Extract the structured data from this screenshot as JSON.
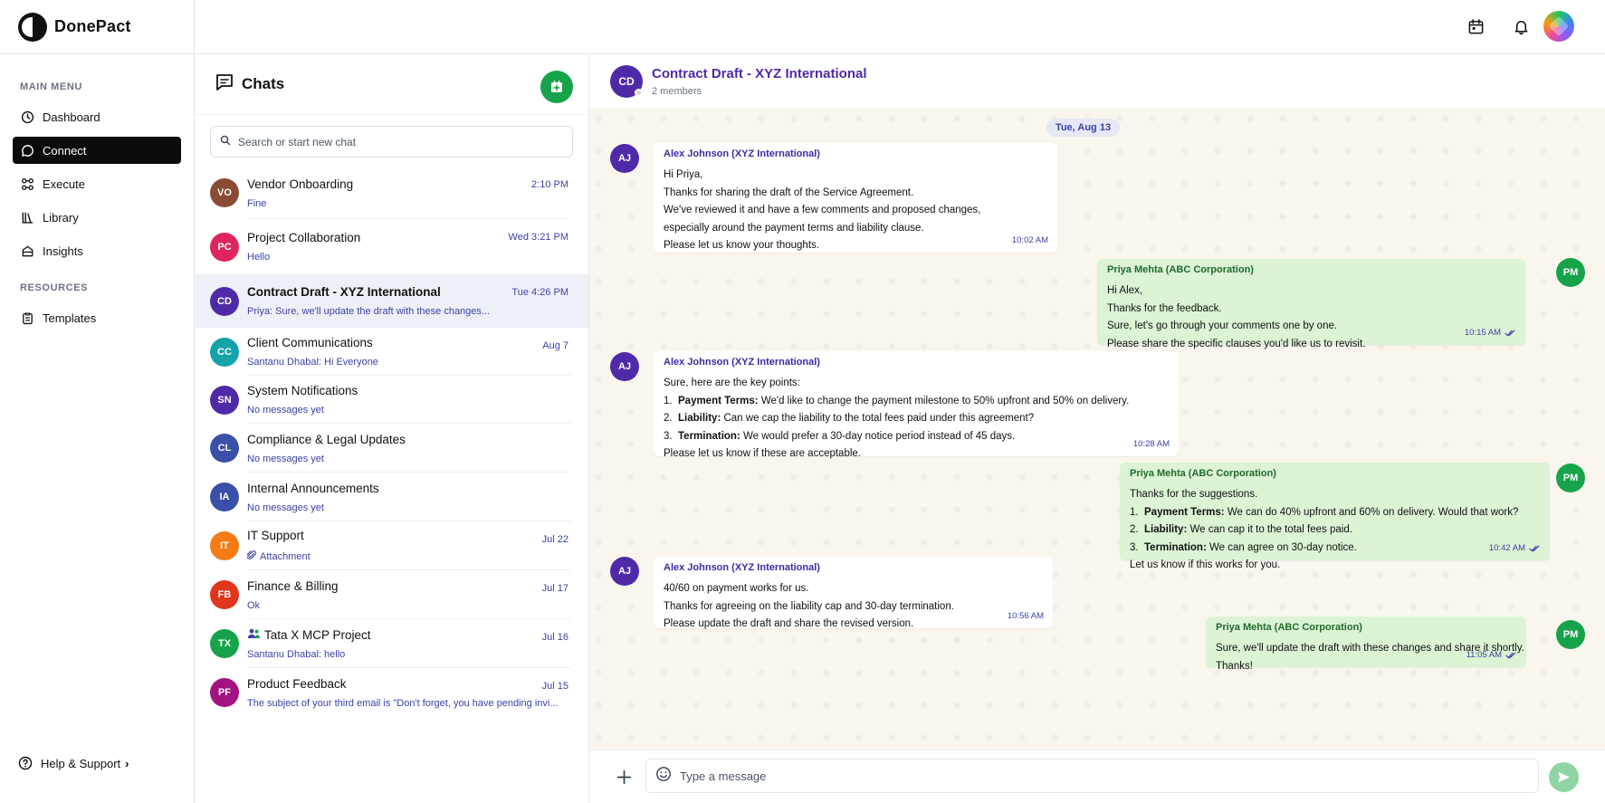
{
  "app": {
    "name": "DonePact"
  },
  "sidebar": {
    "main_menu_label": "MAIN MENU",
    "items": [
      {
        "label": "Dashboard",
        "icon": "clock-icon"
      },
      {
        "label": "Connect",
        "icon": "chat-bubble-icon",
        "active": true
      },
      {
        "label": "Execute",
        "icon": "nodes-icon"
      },
      {
        "label": "Library",
        "icon": "library-icon"
      },
      {
        "label": "Insights",
        "icon": "insights-icon"
      }
    ],
    "resources_label": "RESOURCES",
    "resources": [
      {
        "label": "Templates",
        "icon": "clipboard-icon"
      }
    ],
    "help_label": "Help & Support",
    "help_chevron": "›"
  },
  "topbar": {
    "icons": [
      "calendar-icon",
      "bell-icon",
      "user-avatar"
    ]
  },
  "chatlist": {
    "title": "Chats",
    "search_placeholder": "Search or start new chat",
    "chats": [
      {
        "initials": "VO",
        "color": "#8a4b35",
        "name": "Vendor Onboarding",
        "time": "2:10 PM",
        "preview": "Fine"
      },
      {
        "initials": "PC",
        "color": "#e0245e",
        "name": "Project Collaboration",
        "time": "Wed 3:21 PM",
        "preview": "Hello"
      },
      {
        "initials": "CD",
        "color": "#4f2aa8",
        "name": "Contract Draft - XYZ International",
        "time": "Tue 4:26 PM",
        "preview": "Priya: Sure, we'll update the draft with these changes...",
        "active": true
      },
      {
        "initials": "CC",
        "color": "#14a3a8",
        "name": "Client Communications",
        "time": "Aug 7",
        "preview": "Santanu Dhabal: Hi Everyone"
      },
      {
        "initials": "SN",
        "color": "#4f2aa8",
        "name": "System Notifications",
        "time": "",
        "preview": "No messages yet"
      },
      {
        "initials": "CL",
        "color": "#3a4fa8",
        "name": "Compliance & Legal Updates",
        "time": "",
        "preview": "No messages yet"
      },
      {
        "initials": "IA",
        "color": "#3a4fa8",
        "name": "Internal Announcements",
        "time": "",
        "preview": "No messages yet"
      },
      {
        "initials": "IT",
        "color": "#f47b16",
        "name": "IT Support",
        "time": "Jul 22",
        "preview": "Attachment",
        "preview_icon": "paperclip-icon"
      },
      {
        "initials": "FB",
        "color": "#e0361d",
        "name": "Finance & Billing",
        "time": "Jul 17",
        "preview": "Ok"
      },
      {
        "initials": "TX",
        "color": "#16a34a",
        "name": "Tata X MCP Project",
        "time": "Jul 16",
        "preview": "Santanu Dhabal: hello",
        "name_icon": "group-icon"
      },
      {
        "initials": "PF",
        "color": "#a3137f",
        "name": "Product Feedback",
        "time": "Jul 15",
        "preview": "The subject of your third email is \"Don't forget, you have pending invi..."
      }
    ]
  },
  "conversation": {
    "initials": "CD",
    "title": "Contract Draft - XYZ International",
    "subtitle": "2 members",
    "date_label": "Tue, Aug 13",
    "messages": [
      {
        "dir": "in",
        "initials": "AJ",
        "sender": "Alex Johnson (XYZ International)",
        "time": "10:02 AM",
        "lines": [
          "Hi Priya,",
          "Thanks for sharing the draft of the Service Agreement.",
          "We've reviewed it and have a few comments and proposed changes,",
          "especially around the payment terms and liability clause.",
          "Please let us know your thoughts."
        ]
      },
      {
        "dir": "out",
        "initials": "PM",
        "sender": "Priya Mehta (ABC Corporation)",
        "time": "10:15 AM",
        "lines": [
          "Hi Alex,",
          "Thanks for the feedback.",
          "Sure, let's go through your comments one by one.",
          "Please share the specific clauses you'd like us to revisit."
        ]
      },
      {
        "dir": "in",
        "initials": "AJ",
        "sender": "Alex Johnson (XYZ International)",
        "time": "10:28 AM",
        "intro": "Sure, here are the key points:",
        "points": [
          {
            "num": "1.",
            "key": "Payment Terms:",
            "text": "We'd like to change the payment milestone to 50% upfront and 50% on delivery."
          },
          {
            "num": "2.",
            "key": "Liability:",
            "text": "Can we cap the liability to the total fees paid under this agreement?"
          },
          {
            "num": "3.",
            "key": "Termination:",
            "text": "We would prefer a 30-day notice period instead of 45 days."
          }
        ],
        "outro": "Please let us know if these are acceptable."
      },
      {
        "dir": "out",
        "initials": "PM",
        "sender": "Priya Mehta (ABC Corporation)",
        "time": "10:42 AM",
        "intro": "Thanks for the suggestions.",
        "points": [
          {
            "num": "1.",
            "key": "Payment Terms:",
            "text": "We can do 40% upfront and 60% on delivery. Would that work?"
          },
          {
            "num": "2.",
            "key": "Liability:",
            "text": "We can cap it to the total fees paid."
          },
          {
            "num": "3.",
            "key": "Termination:",
            "text": "We can agree on 30-day notice."
          }
        ],
        "outro": "Let us know if this works for you."
      },
      {
        "dir": "in",
        "initials": "AJ",
        "sender": "Alex Johnson (XYZ International)",
        "time": "10:56 AM",
        "lines": [
          "40/60 on payment works for us.",
          "Thanks for agreeing on the liability cap and 30-day termination.",
          "Please update the draft and share the revised version."
        ]
      },
      {
        "dir": "out",
        "initials": "PM",
        "sender": "Priya Mehta (ABC Corporation)",
        "time": "11:05 AM",
        "lines": [
          "Sure, we'll update the draft with these changes and share it shortly.",
          "Thanks!"
        ]
      }
    ],
    "composer_placeholder": "Type a message"
  },
  "colors": {
    "accent": "#4f2aa8",
    "brand_green": "#16a34a",
    "in_avatar": "#4f2aa8",
    "out_avatar": "#16a34a",
    "link_blue": "#3b41a8",
    "out_bubble": "#dcf3d4"
  }
}
